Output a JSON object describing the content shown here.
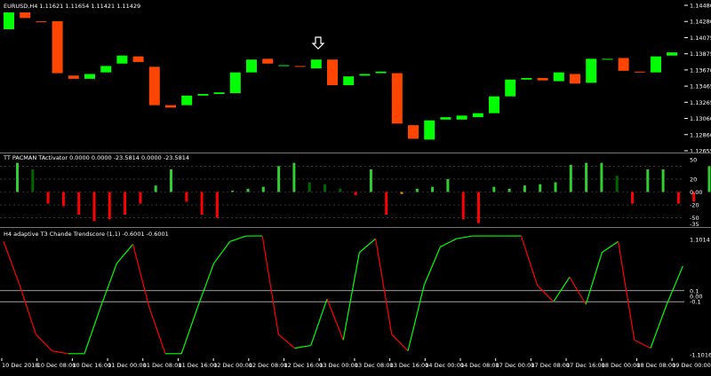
{
  "colors": {
    "bull": "#00ff00",
    "bear": "#ff4500",
    "hist_bright": "#32cd32",
    "hist_dark": "#006400",
    "hist_red": "#ff0000",
    "hist_orange": "#ff8c00",
    "line_up": "#00ff00",
    "line_down": "#ff0000",
    "grid": "#ffffff",
    "dotted": "#555555"
  },
  "main_panel": {
    "header": "EURUSD,H4  1.11621 1.11654 1.11421 1.11429",
    "marker_icon": "down-arrow-icon",
    "price_labels": [
      "1.14480",
      "1.14280",
      "1.14075",
      "1.13875",
      "1.13670",
      "1.13465",
      "1.13265",
      "1.13060",
      "1.12860",
      "1.12655"
    ]
  },
  "indicator1": {
    "header": "TT PACMAN TActivator 0.0000 0.0000 -23.5814 0.0000 -23.5814",
    "scale_labels": [
      "20",
      "0.00",
      "-20",
      "-50",
      "-35"
    ],
    "top_labels": [
      "50"
    ]
  },
  "indicator2": {
    "header": "H4  adaptive T3 Chande Trendscore (1,1) -0.6001 -0.6001",
    "scale_labels": [
      "1.1014",
      "0.1",
      "0.00",
      "-0.1",
      "-1.1016"
    ]
  },
  "time_labels": [
    "10 Dec 2018",
    "10 Dec 08:00",
    "10 Dec 16:00",
    "11 Dec 00:00",
    "11 Dec 08:00",
    "11 Dec 16:00",
    "12 Dec 00:00",
    "12 Dec 08:00",
    "12 Dec 16:00",
    "13 Dec 00:00",
    "13 Dec 08:00",
    "13 Dec 16:00",
    "14 Dec 00:00",
    "14 Dec 08:00",
    "17 Dec 00:00",
    "17 Dec 08:00",
    "17 Dec 16:00",
    "18 Dec 00:00",
    "18 Dec 08:00",
    "19 Dec 00:00"
  ],
  "chart_data": [
    {
      "type": "candlestick",
      "title": "EURUSD,H4",
      "ohlc_info": [
        "1.11621",
        "1.11654",
        "1.11421",
        "1.11429"
      ],
      "candles": [
        {
          "o": 1.1417,
          "c": 1.1438,
          "d": "bull"
        },
        {
          "o": 1.1438,
          "c": 1.1431,
          "d": "bear"
        },
        {
          "o": 1.1426,
          "c": 1.1427,
          "d": "bear"
        },
        {
          "o": 1.1427,
          "c": 1.1362,
          "d": "bear"
        },
        {
          "o": 1.1359,
          "c": 1.1355,
          "d": "bear"
        },
        {
          "o": 1.1355,
          "c": 1.1361,
          "d": "bull"
        },
        {
          "o": 1.1363,
          "c": 1.1371,
          "d": "bull"
        },
        {
          "o": 1.1374,
          "c": 1.1384,
          "d": "bull"
        },
        {
          "o": 1.1383,
          "c": 1.1376,
          "d": "bear"
        },
        {
          "o": 1.137,
          "c": 1.1322,
          "d": "bear"
        },
        {
          "o": 1.1322,
          "c": 1.1319,
          "d": "bear"
        },
        {
          "o": 1.1322,
          "c": 1.1334,
          "d": "bull"
        },
        {
          "o": 1.1334,
          "c": 1.1336,
          "d": "bull"
        },
        {
          "o": 1.1336,
          "c": 1.1338,
          "d": "bull"
        },
        {
          "o": 1.1337,
          "c": 1.1363,
          "d": "bull"
        },
        {
          "o": 1.1363,
          "c": 1.1379,
          "d": "bull"
        },
        {
          "o": 1.138,
          "c": 1.1374,
          "d": "bear"
        },
        {
          "o": 1.1372,
          "c": 1.1372,
          "d": "bull"
        },
        {
          "o": 1.1371,
          "c": 1.137,
          "d": "bear"
        },
        {
          "o": 1.1368,
          "c": 1.1379,
          "d": "bull"
        },
        {
          "o": 1.1379,
          "c": 1.1347,
          "d": "bear"
        },
        {
          "o": 1.1347,
          "c": 1.1358,
          "d": "bull"
        },
        {
          "o": 1.1359,
          "c": 1.1361,
          "d": "bull"
        },
        {
          "o": 1.1362,
          "c": 1.1364,
          "d": "bull"
        },
        {
          "o": 1.1362,
          "c": 1.1299,
          "d": "bear"
        },
        {
          "o": 1.1297,
          "c": 1.128,
          "d": "bear"
        },
        {
          "o": 1.1279,
          "c": 1.1303,
          "d": "bull"
        },
        {
          "o": 1.1304,
          "c": 1.1307,
          "d": "bull"
        },
        {
          "o": 1.1304,
          "c": 1.1309,
          "d": "bull"
        },
        {
          "o": 1.1307,
          "c": 1.1312,
          "d": "bull"
        },
        {
          "o": 1.1312,
          "c": 1.1333,
          "d": "bull"
        },
        {
          "o": 1.1333,
          "c": 1.1354,
          "d": "bull"
        },
        {
          "o": 1.1354,
          "c": 1.1356,
          "d": "bull"
        },
        {
          "o": 1.1356,
          "c": 1.1353,
          "d": "bear"
        },
        {
          "o": 1.1352,
          "c": 1.1363,
          "d": "bull"
        },
        {
          "o": 1.1361,
          "c": 1.1349,
          "d": "bear"
        },
        {
          "o": 1.135,
          "c": 1.138,
          "d": "bull"
        },
        {
          "o": 1.138,
          "c": 1.1379,
          "d": "bull"
        },
        {
          "o": 1.1381,
          "c": 1.1365,
          "d": "bear"
        },
        {
          "o": 1.1364,
          "c": 1.1363,
          "d": "bear"
        },
        {
          "o": 1.1363,
          "c": 1.1383,
          "d": "bull"
        },
        {
          "o": 1.1384,
          "c": 1.1388,
          "d": "bull"
        }
      ],
      "ylim": [
        1.1265,
        1.1448
      ]
    },
    {
      "type": "histogram",
      "title": "TT PACMAN TActivator",
      "ylim": [
        -50,
        50
      ],
      "bars": [
        {
          "v": 45,
          "c": "hist_bright"
        },
        {
          "v": 35,
          "c": "hist_dark"
        },
        {
          "v": -18,
          "c": "hist_red"
        },
        {
          "v": -22,
          "c": "hist_red"
        },
        {
          "v": -35,
          "c": "hist_red"
        },
        {
          "v": -45,
          "c": "hist_red"
        },
        {
          "v": -42,
          "c": "hist_red"
        },
        {
          "v": -35,
          "c": "hist_red"
        },
        {
          "v": -18,
          "c": "hist_red"
        },
        {
          "v": 10,
          "c": "hist_bright"
        },
        {
          "v": 35,
          "c": "hist_bright"
        },
        {
          "v": -15,
          "c": "hist_red"
        },
        {
          "v": -35,
          "c": "hist_red"
        },
        {
          "v": -40,
          "c": "hist_red"
        },
        {
          "v": 2,
          "c": "hist_bright"
        },
        {
          "v": 5,
          "c": "hist_bright"
        },
        {
          "v": 8,
          "c": "hist_bright"
        },
        {
          "v": 40,
          "c": "hist_bright"
        },
        {
          "v": 45,
          "c": "hist_bright"
        },
        {
          "v": 15,
          "c": "hist_dark"
        },
        {
          "v": 12,
          "c": "hist_dark"
        },
        {
          "v": 5,
          "c": "hist_dark"
        },
        {
          "v": -5,
          "c": "hist_red"
        },
        {
          "v": 35,
          "c": "hist_bright"
        },
        {
          "v": -35,
          "c": "hist_red"
        },
        {
          "v": -3,
          "c": "hist_orange"
        },
        {
          "v": 5,
          "c": "hist_bright"
        },
        {
          "v": 8,
          "c": "hist_bright"
        },
        {
          "v": 20,
          "c": "hist_bright"
        },
        {
          "v": -42,
          "c": "hist_red"
        },
        {
          "v": -48,
          "c": "hist_red"
        },
        {
          "v": 8,
          "c": "hist_bright"
        },
        {
          "v": 5,
          "c": "hist_bright"
        },
        {
          "v": 10,
          "c": "hist_bright"
        },
        {
          "v": 12,
          "c": "hist_bright"
        },
        {
          "v": 15,
          "c": "hist_bright"
        },
        {
          "v": 42,
          "c": "hist_bright"
        },
        {
          "v": 45,
          "c": "hist_bright"
        },
        {
          "v": 45,
          "c": "hist_bright"
        },
        {
          "v": 25,
          "c": "hist_dark"
        },
        {
          "v": -18,
          "c": "hist_red"
        },
        {
          "v": 35,
          "c": "hist_bright"
        },
        {
          "v": 35,
          "c": "hist_bright"
        },
        {
          "v": -18,
          "c": "hist_red"
        },
        {
          "v": -15,
          "c": "hist_red"
        },
        {
          "v": 40,
          "c": "hist_bright"
        }
      ]
    },
    {
      "type": "line",
      "title": "adaptive T3 Chande Trendscore (1,1)",
      "ylim": [
        -1.1016,
        1.1014
      ],
      "points": [
        {
          "t": 0,
          "v": 1.0
        },
        {
          "t": 1,
          "v": 0.2
        },
        {
          "t": 2,
          "v": -0.7
        },
        {
          "t": 3,
          "v": -1.0
        },
        {
          "t": 4,
          "v": -1.05
        },
        {
          "t": 5,
          "v": -1.05
        },
        {
          "t": 6,
          "v": -0.2
        },
        {
          "t": 7,
          "v": 0.6
        },
        {
          "t": 8,
          "v": 0.95
        },
        {
          "t": 9,
          "v": -0.2
        },
        {
          "t": 10,
          "v": -1.05
        },
        {
          "t": 11,
          "v": -1.05
        },
        {
          "t": 12,
          "v": -0.2
        },
        {
          "t": 13,
          "v": 0.6
        },
        {
          "t": 14,
          "v": 1.0
        },
        {
          "t": 15,
          "v": 1.1
        },
        {
          "t": 16,
          "v": 1.1
        },
        {
          "t": 17,
          "v": -0.7
        },
        {
          "t": 18,
          "v": -0.95
        },
        {
          "t": 19,
          "v": -0.9
        },
        {
          "t": 20,
          "v": -0.05
        },
        {
          "t": 21,
          "v": -0.8
        },
        {
          "t": 22,
          "v": 0.8
        },
        {
          "t": 23,
          "v": 1.05
        },
        {
          "t": 24,
          "v": -0.7
        },
        {
          "t": 25,
          "v": -1.0
        },
        {
          "t": 26,
          "v": 0.2
        },
        {
          "t": 27,
          "v": 0.9
        },
        {
          "t": 28,
          "v": 1.05
        },
        {
          "t": 29,
          "v": 1.1
        },
        {
          "t": 30,
          "v": 1.1
        },
        {
          "t": 31,
          "v": 1.1
        },
        {
          "t": 32,
          "v": 1.1
        },
        {
          "t": 33,
          "v": 0.2
        },
        {
          "t": 34,
          "v": -0.1
        },
        {
          "t": 35,
          "v": 0.35
        },
        {
          "t": 36,
          "v": -0.15
        },
        {
          "t": 37,
          "v": 0.8
        },
        {
          "t": 38,
          "v": 1.0
        },
        {
          "t": 39,
          "v": -0.8
        },
        {
          "t": 40,
          "v": -0.95
        },
        {
          "t": 41,
          "v": -0.15
        },
        {
          "t": 42,
          "v": 0.55
        }
      ]
    }
  ]
}
